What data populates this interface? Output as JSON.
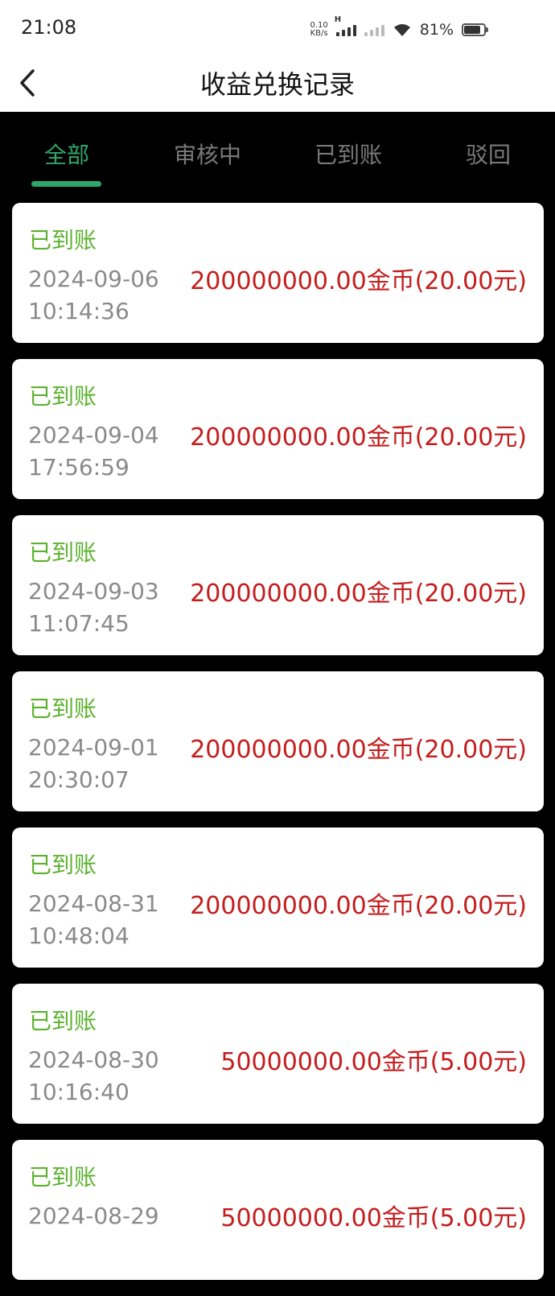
{
  "status_bar": {
    "time": "21:08",
    "net_speed_value": "0.10",
    "net_speed_unit": "KB/s",
    "network_type": "H",
    "battery": "81%"
  },
  "nav": {
    "title": "收益兑换记录",
    "back_icon": "chevron-left-icon"
  },
  "tabs": [
    {
      "label": "全部",
      "active": true
    },
    {
      "label": "审核中",
      "active": false
    },
    {
      "label": "已到账",
      "active": false
    },
    {
      "label": "驳回",
      "active": false
    }
  ],
  "records": [
    {
      "status": "已到账",
      "date": "2024-09-06",
      "time": "10:14:36",
      "amount": "200000000.00金币(20.00元)"
    },
    {
      "status": "已到账",
      "date": "2024-09-04",
      "time": "17:56:59",
      "amount": "200000000.00金币(20.00元)"
    },
    {
      "status": "已到账",
      "date": "2024-09-03",
      "time": "11:07:45",
      "amount": "200000000.00金币(20.00元)"
    },
    {
      "status": "已到账",
      "date": "2024-09-01",
      "time": "20:30:07",
      "amount": "200000000.00金币(20.00元)"
    },
    {
      "status": "已到账",
      "date": "2024-08-31",
      "time": "10:48:04",
      "amount": "200000000.00金币(20.00元)"
    },
    {
      "status": "已到账",
      "date": "2024-08-30",
      "time": "10:16:40",
      "amount": "50000000.00金币(5.00元)"
    },
    {
      "status": "已到账",
      "date": "2024-08-29",
      "time": "",
      "amount": "50000000.00金币(5.00元)"
    }
  ],
  "colors": {
    "accent": "#2ea86a",
    "status_green": "#5cb22e",
    "amount_red": "#c41d1d",
    "muted_text": "#8a8a8a"
  }
}
